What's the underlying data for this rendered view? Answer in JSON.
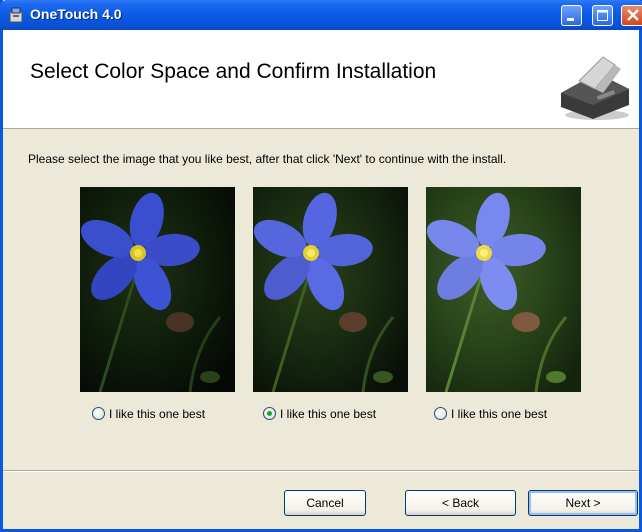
{
  "window": {
    "title": "OneTouch 4.0"
  },
  "header": {
    "title": "Select Color Space and Confirm Installation"
  },
  "main": {
    "instruction": "Please select the image that you like best, after that click 'Next' to continue with the install.",
    "options": [
      {
        "label": "I like this one best",
        "selected": false
      },
      {
        "label": "I like this one best",
        "selected": true
      },
      {
        "label": "I like this one best",
        "selected": false
      }
    ]
  },
  "footer": {
    "cancel_label": "Cancel",
    "back_label": "< Back",
    "next_label": "Next >"
  },
  "colors": {
    "titlebar": "#0a5ae4",
    "dialog_bg": "#ece9d8",
    "radio_selected": "#21a121"
  }
}
